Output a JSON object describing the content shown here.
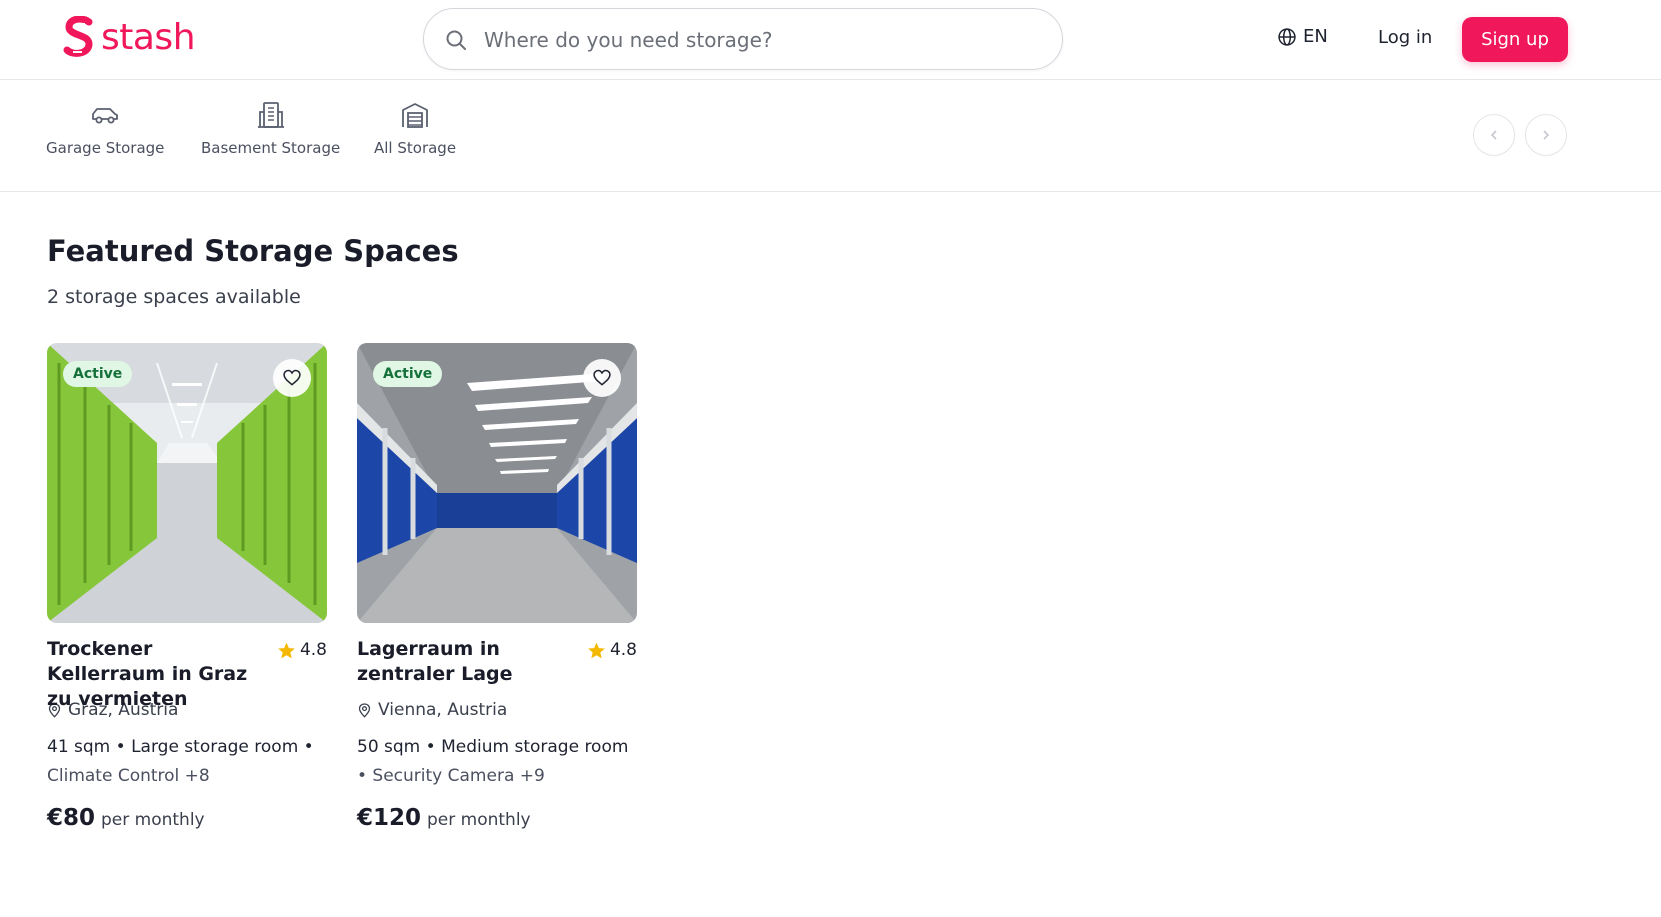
{
  "brand": {
    "name": "stash",
    "color": "#f0185a"
  },
  "header": {
    "search": {
      "placeholder": "Where do you need storage?"
    },
    "language": "EN",
    "login_label": "Log in",
    "signup_label": "Sign up"
  },
  "categories": [
    {
      "label": "Garage Storage",
      "icon": "car-icon"
    },
    {
      "label": "Basement Storage",
      "icon": "building-icon"
    },
    {
      "label": "All Storage",
      "icon": "warehouse-icon"
    }
  ],
  "main": {
    "heading": "Featured Storage Spaces",
    "subheading": "2 storage spaces available"
  },
  "listings": [
    {
      "status": "Active",
      "title": "Trockener Kellerraum in Graz zu vermieten",
      "rating": "4.8",
      "location": "Graz, Austria",
      "features_main": "41 sqm • Large storage room •",
      "features_extra": "Climate Control +8",
      "price": "€80",
      "price_unit": "per monthly",
      "image": "green-storage-corridor"
    },
    {
      "status": "Active",
      "title": "Lagerraum in zentraler Lage",
      "rating": "4.8",
      "location": "Vienna, Austria",
      "features_main": "50 sqm • Medium storage room",
      "features_extra": "• Security Camera +9",
      "price": "€120",
      "price_unit": "per monthly",
      "image": "blue-storage-corridor"
    }
  ]
}
